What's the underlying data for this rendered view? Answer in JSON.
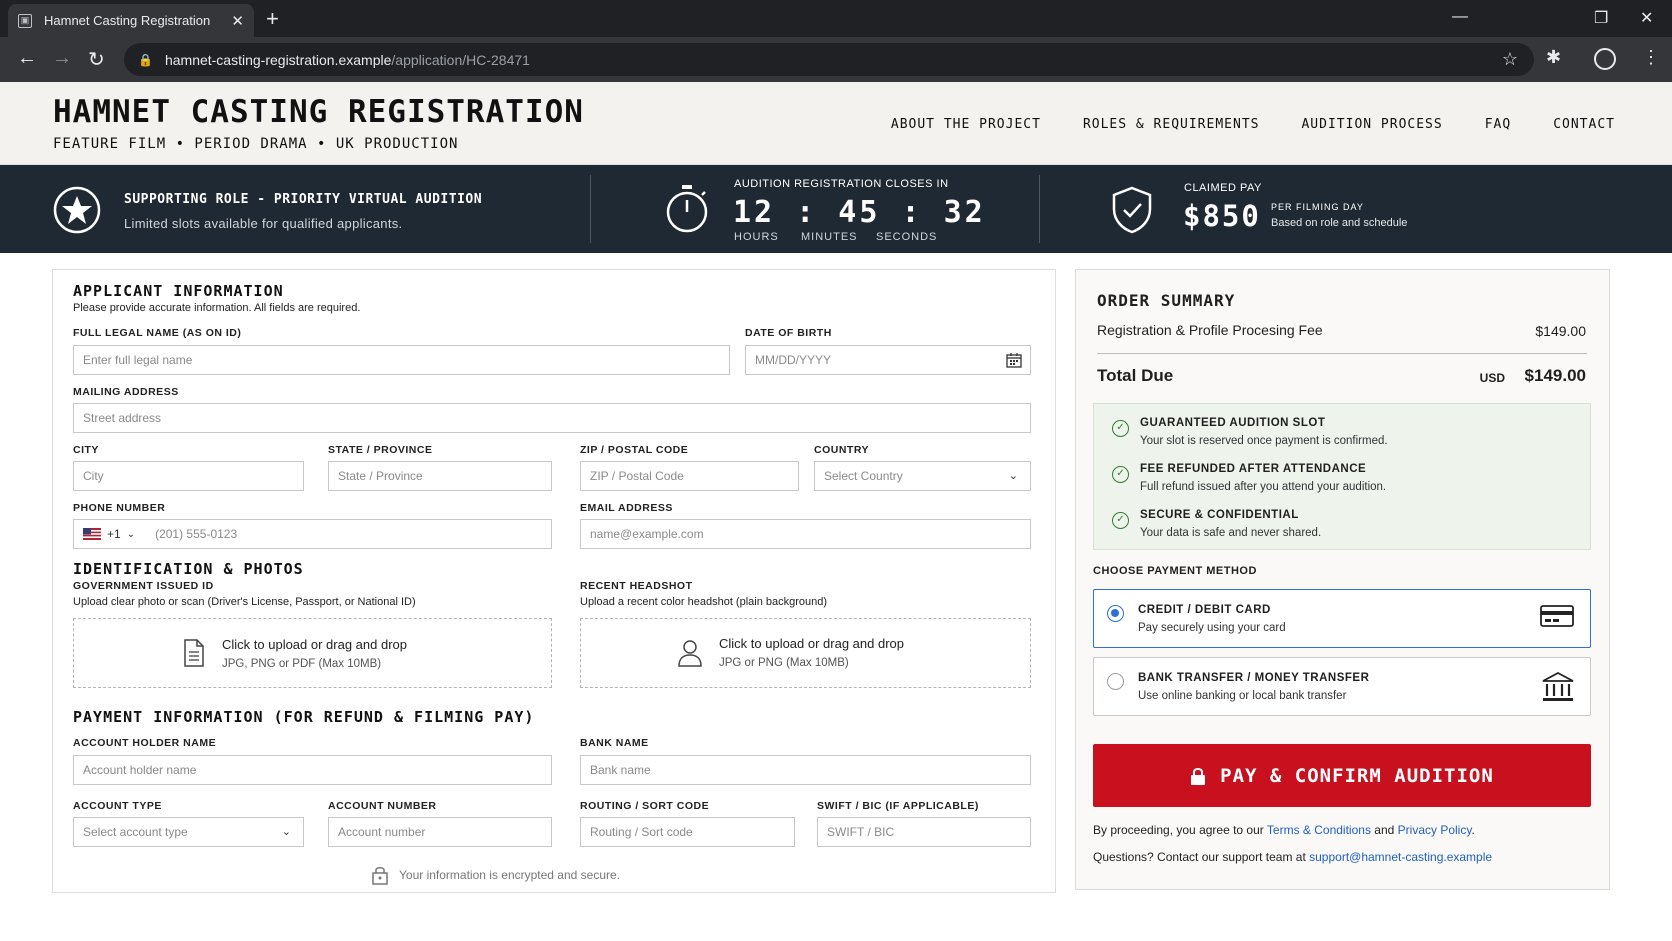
{
  "browser": {
    "tab_title": "Hamnet Casting Registration",
    "url_host": "hamnet-casting-registration.example",
    "url_path": "/application/HC-28471"
  },
  "site": {
    "title": "HAMNET CASTING REGISTRATION",
    "subtitle": "FEATURE FILM • PERIOD DRAMA • UK PRODUCTION",
    "nav": [
      "ABOUT THE PROJECT",
      "ROLES & REQUIREMENTS",
      "AUDITION PROCESS",
      "FAQ",
      "CONTACT"
    ]
  },
  "banner": {
    "role_title": "SUPPORTING ROLE - PRIORITY VIRTUAL AUDITION",
    "role_sub": "Limited slots available for qualified applicants.",
    "closes_label": "AUDITION REGISTRATION CLOSES IN",
    "timer": "12 : 45 : 32",
    "units": [
      "HOURS",
      "MINUTES",
      "SECONDS"
    ],
    "pay_label": "CLAIMED PAY",
    "pay_amount": "$850",
    "pay_per": "PER FILMING DAY",
    "pay_basis": "Based on role and schedule"
  },
  "form": {
    "applicant": {
      "title": "APPLICANT INFORMATION",
      "hint": "Please provide accurate information. All fields are required.",
      "name_label": "FULL LEGAL NAME (AS ON ID)",
      "name_ph": "Enter full legal name",
      "dob_label": "DATE OF BIRTH",
      "dob_ph": "MM/DD/YYYY",
      "address_label": "MAILING ADDRESS",
      "address_ph": "Street address",
      "city_label": "CITY",
      "city_ph": "City",
      "state_label": "STATE / PROVINCE",
      "state_ph": "State / Province",
      "zip_label": "ZIP / POSTAL CODE",
      "zip_ph": "ZIP / Postal Code",
      "country_label": "COUNTRY",
      "country_value": "Select Country",
      "phone_label": "PHONE NUMBER",
      "phone_code": "+1",
      "phone_ph": "(201) 555-0123",
      "email_label": "EMAIL ADDRESS",
      "email_ph": "name@example.com"
    },
    "ids": {
      "title": "IDENTIFICATION & PHOTOS",
      "gov_label": "GOVERNMENT ISSUED ID",
      "gov_hint": "Upload clear photo or scan (Driver's License, Passport, or National ID)",
      "gov_main": "Click to upload or drag and drop",
      "gov_sub": "JPG, PNG or PDF (Max 10MB)",
      "head_label": "RECENT HEADSHOT",
      "head_hint": "Upload a recent color headshot (plain background)",
      "head_main": "Click to upload or drag and drop",
      "head_sub": "JPG or PNG (Max 10MB)"
    },
    "payment": {
      "title": "PAYMENT INFORMATION (FOR REFUND & FILMING PAY)",
      "holder_label": "ACCOUNT HOLDER NAME",
      "holder_ph": "Account holder name",
      "bank_label": "BANK NAME",
      "bank_ph": "Bank name",
      "type_label": "ACCOUNT TYPE",
      "type_value": "Select account type",
      "number_label": "ACCOUNT NUMBER",
      "number_ph": "Account number",
      "routing_label": "ROUTING / SORT CODE",
      "routing_ph": "Routing / Sort code",
      "swift_label": "SWIFT / BIC (IF APPLICABLE)",
      "swift_ph": "SWIFT / BIC",
      "secure_note": "Your information is encrypted and secure."
    }
  },
  "summary": {
    "title": "ORDER SUMMARY",
    "fee_label": "Registration & Profile Procesing Fee",
    "fee_value": "$149.00",
    "total_label": "Total Due",
    "total_currency": "USD",
    "total_value": "$149.00",
    "guarantees": [
      {
        "title": "GUARANTEED AUDITION SLOT",
        "sub": "Your slot is reserved once payment is confirmed."
      },
      {
        "title": "FEE REFUNDED AFTER ATTENDANCE",
        "sub": "Full refund issued after you attend your audition."
      },
      {
        "title": "SECURE & CONFIDENTIAL",
        "sub": "Your data is safe and never shared."
      }
    ],
    "choose_label": "CHOOSE PAYMENT METHOD",
    "methods": [
      {
        "title": "CREDIT / DEBIT CARD",
        "sub": "Pay securely using your card"
      },
      {
        "title": "BANK TRANSFER / MONEY TRANSFER",
        "sub": "Use online banking or local bank transfer"
      }
    ],
    "pay_button": "PAY & CONFIRM AUDITION",
    "terms_pre": "By proceeding, you agree to our ",
    "terms_link": "Terms & Conditions",
    "terms_and": " and ",
    "privacy_link": "Privacy Policy",
    "terms_end": ".",
    "support_pre": "Questions? Contact our support team at ",
    "support_email": "support@hamnet-casting.example"
  },
  "colors": {
    "banner_bg": "#1f2933",
    "pay_button": "#c8101e",
    "accent_blue": "#2f6fd6",
    "check_green": "#2e7d32"
  }
}
